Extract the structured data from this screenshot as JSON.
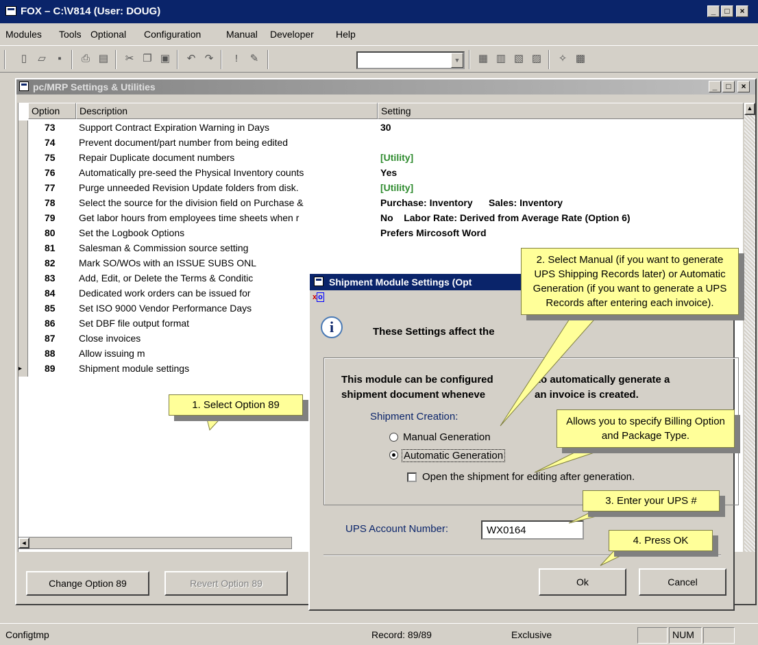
{
  "app": {
    "title": "FOX – C:\\V814  (User: DOUG)"
  },
  "menu": [
    "Modules",
    "Tools",
    "Optional",
    "Configuration",
    "Manual",
    "Developer",
    "Help"
  ],
  "child": {
    "title": "pc/MRP Settings & Utilities"
  },
  "grid": {
    "headers": {
      "option": "Option",
      "description": "Description",
      "setting": "Setting"
    },
    "rows": [
      {
        "option": "73",
        "description": "Support Contract Expiration Warning in Days",
        "setting": "30"
      },
      {
        "option": "74",
        "description": "Prevent document/part number from being edited",
        "setting": ""
      },
      {
        "option": "75",
        "description": "Repair Duplicate document numbers",
        "setting": "[Utility]"
      },
      {
        "option": "76",
        "description": "Automatically pre-seed the Physical Inventory counts",
        "setting": "Yes"
      },
      {
        "option": "77",
        "description": "Purge unneeded Revision Update folders from disk.",
        "setting": "[Utility]"
      },
      {
        "option": "78",
        "description": "Select the source for the division field on Purchase &",
        "setting": "Purchase: Inventory      Sales: Inventory"
      },
      {
        "option": "79",
        "description": "Get labor hours from employees time sheets when r",
        "setting": "No    Labor Rate: Derived from Average Rate (Option 6)"
      },
      {
        "option": "80",
        "description": "Set the Logbook Options",
        "setting": "Prefers Mircosoft Word"
      },
      {
        "option": "81",
        "description": "Salesman & Commission source setting",
        "setting": ""
      },
      {
        "option": "82",
        "description": "Mark SO/WOs with an ISSUE SUBS ONL",
        "setting": ""
      },
      {
        "option": "83",
        "description": "Add, Edit, or Delete the Terms & Conditic",
        "setting": ""
      },
      {
        "option": "84",
        "description": "Dedicated work orders can be issued for",
        "setting": ""
      },
      {
        "option": "85",
        "description": "Set ISO 9000 Vendor Performance Days",
        "setting": ""
      },
      {
        "option": "86",
        "description": "Set DBF file output format",
        "setting": ""
      },
      {
        "option": "87",
        "description": "Close invoices",
        "setting": ""
      },
      {
        "option": "88",
        "description": "Allow issuing m",
        "setting": ""
      },
      {
        "option": "89",
        "description": "Shipment module settings",
        "setting": ""
      }
    ]
  },
  "buttons": {
    "change": "Change Option 89",
    "revert": "Revert Option 89"
  },
  "dialog": {
    "title": "Shipment Module Settings  (Opt",
    "info": "These Settings affect the",
    "desc1": "This module can be configured",
    "desc1b": "to automatically generate a",
    "desc2": "shipment document wheneve",
    "desc2b": "an invoice is created.",
    "creation_label": "Shipment Creation:",
    "manual": "Manual Generation",
    "automatic": "Automatic Generation",
    "open_edit": "Open the shipment for editing after generation.",
    "ups_label": "UPS Account Number:",
    "ups_value": "WX0164",
    "ok": "Ok",
    "cancel": "Cancel"
  },
  "callouts": {
    "c1": "1. Select Option 89",
    "c2": "2. Select Manual (if you want to generate UPS Shipping Records later) or Automatic Generation (if you want to generate a UPS Records after entering each invoice).",
    "c3": "Allows you to specify Billing Option and Package Type.",
    "c4": "3. Enter your UPS #",
    "c5": "4. Press OK"
  },
  "status": {
    "file": "Configtmp",
    "record": "Record: 89/89",
    "mode": "Exclusive",
    "num": "NUM"
  },
  "colors": {
    "utility": "#2e8b2e",
    "title": "#0a246a"
  }
}
